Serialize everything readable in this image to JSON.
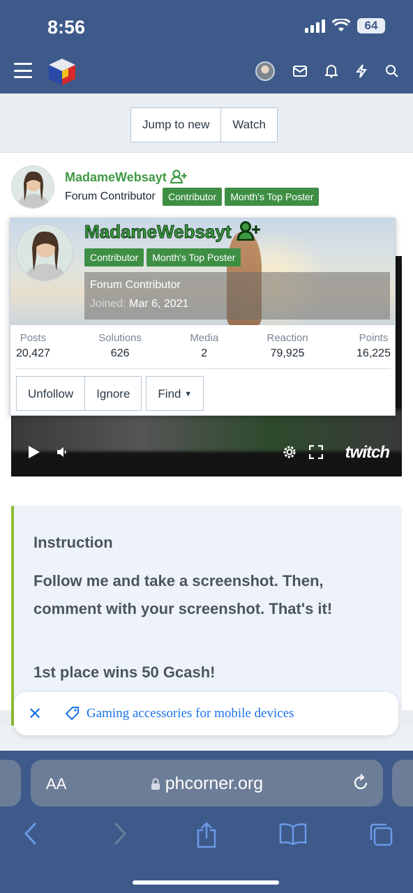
{
  "status": {
    "time": "8:56",
    "battery": "64"
  },
  "header": {
    "menu_icon": "hamburger-icon",
    "logo": "phcorner-logo",
    "icons": [
      "avatar",
      "inbox-icon",
      "bell-icon",
      "bolt-icon",
      "search-icon"
    ]
  },
  "actions": {
    "jump": "Jump to new",
    "watch": "Watch"
  },
  "post": {
    "author": "MadameWebsayt",
    "title": "Forum Contributor",
    "badges": [
      "Contributor",
      "Month's Top Poster"
    ]
  },
  "popup": {
    "name": "MadameWebsayt",
    "badges": [
      "Contributor",
      "Month's Top Poster"
    ],
    "title": "Forum Contributor",
    "joined_label": "Joined:",
    "joined_date": "Mar 6, 2021",
    "stats": [
      {
        "label": "Posts",
        "value": "20,427"
      },
      {
        "label": "Solutions",
        "value": "626"
      },
      {
        "label": "Media",
        "value": "2"
      },
      {
        "label": "Reaction",
        "value": "79,925"
      },
      {
        "label": "Points",
        "value": "16,225"
      }
    ],
    "buttons": {
      "unfollow": "Unfollow",
      "ignore": "Ignore",
      "find": "Find"
    }
  },
  "video": {
    "brand": "twitch"
  },
  "instruction": {
    "heading": "Instruction",
    "body": "Follow me and take a screenshot. Then, comment with your screenshot. That's it!",
    "prize": "1st place wins 50 Gcash!"
  },
  "ad": {
    "text": "Gaming accessories for mobile devices"
  },
  "browser": {
    "aa": "AA",
    "url": "phcorner.org"
  },
  "colors": {
    "header": "#3d5a8a",
    "accent_green": "#3e9a42",
    "badge_green": "#3e8f44",
    "quote_border": "#8fbd34"
  }
}
